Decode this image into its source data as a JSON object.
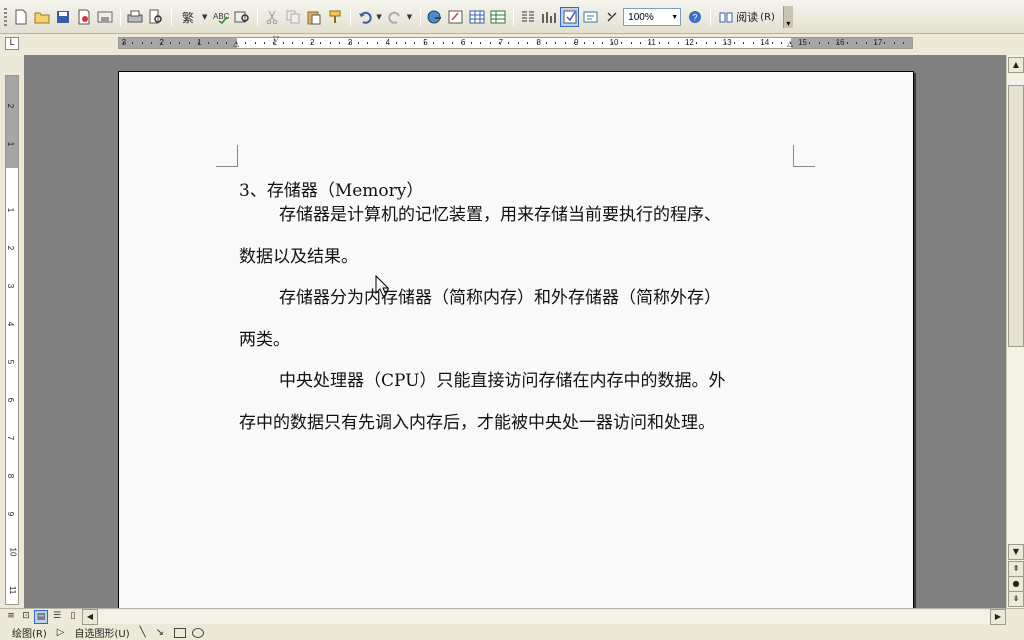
{
  "toolbar": {
    "zoom_value": "100%",
    "read_label": "阅读",
    "read_shortcut": "(R)",
    "traditional_chinese_label": "繁"
  },
  "ruler": {
    "h_labels": [
      "3",
      "2",
      "1",
      "1",
      "2",
      "3",
      "4",
      "5",
      "6",
      "7",
      "8",
      "9",
      "10",
      "11",
      "12",
      "13",
      "14",
      "15",
      "16",
      "17"
    ],
    "v_labels": [
      "2",
      "1",
      "1",
      "2",
      "3",
      "4",
      "5",
      "6",
      "7",
      "8",
      "9",
      "10",
      "11"
    ]
  },
  "document": {
    "heading": "3、存储器（Memory）",
    "paragraphs": [
      {
        "line1": "存储器是计算机的记忆装置，用来存储当前要执行的程序、",
        "line2": "数据以及结果。"
      },
      {
        "line1": "存储器分为内存储器（简称内存）和外存储器（简称外存）",
        "line2": "两类。"
      },
      {
        "line1": "中央处理器（CPU）只能直接访问存储在内存中的数据。外",
        "line2": "存中的数据只有先调入内存后，才能被中央处一器访问和处理。"
      }
    ]
  },
  "drawing_toolbar": {
    "draw_label": "绘图(R)",
    "autoshapes_label": "自选图形(U)"
  },
  "icons": [
    "new-icon",
    "open-icon",
    "save-icon",
    "permission-icon",
    "email-icon",
    "print-icon",
    "print-preview-icon",
    "spelling-icon",
    "research-icon",
    "cut-icon",
    "copy-icon",
    "paste-icon",
    "format-painter-icon",
    "undo-icon",
    "redo-icon",
    "hyperlink-icon",
    "tables-borders-icon",
    "insert-table-icon",
    "insert-excel-icon",
    "columns-icon",
    "drawing-icon",
    "document-map-icon",
    "show-hide-icon",
    "help-icon",
    "read-icon"
  ],
  "colors": {
    "page_background": "#f9f9f9",
    "workspace": "#808080",
    "chrome": "#ece9d8",
    "active_highlight": "#c1d2ee"
  }
}
